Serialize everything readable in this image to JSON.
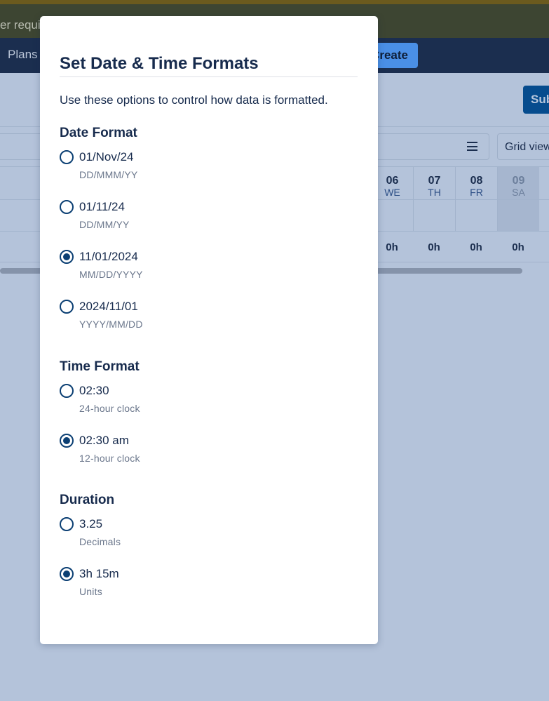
{
  "background": {
    "banner_text": "er requi",
    "nav_plans": "Plans",
    "nav_create": "Create",
    "submit_button": "Sub",
    "grid_view": "Grid view",
    "days": [
      {
        "date": "06",
        "weekday": "WE",
        "hours": "0h",
        "weekend": false
      },
      {
        "date": "07",
        "weekday": "TH",
        "hours": "0h",
        "weekend": false
      },
      {
        "date": "08",
        "weekday": "FR",
        "hours": "0h",
        "weekend": false
      },
      {
        "date": "09",
        "weekday": "SA",
        "hours": "0h",
        "weekend": true
      }
    ]
  },
  "modal": {
    "title": "Set Date & Time Formats",
    "description": "Use these options to control how data is formatted.",
    "sections": [
      {
        "heading": "Date Format",
        "options": [
          {
            "label": "01/Nov/24",
            "sub": "DD/MMM/YY",
            "checked": false
          },
          {
            "label": "01/11/24",
            "sub": "DD/MM/YY",
            "checked": false
          },
          {
            "label": "11/01/2024",
            "sub": "MM/DD/YYYY",
            "checked": true
          },
          {
            "label": "2024/11/01",
            "sub": "YYYY/MM/DD",
            "checked": false
          }
        ]
      },
      {
        "heading": "Time Format",
        "options": [
          {
            "label": "02:30",
            "sub": "24-hour clock",
            "checked": false
          },
          {
            "label": "02:30 am",
            "sub": "12-hour clock",
            "checked": true
          }
        ]
      },
      {
        "heading": "Duration",
        "options": [
          {
            "label": "3.25",
            "sub": "Decimals",
            "checked": false
          },
          {
            "label": "3h 15m",
            "sub": "Units",
            "checked": true
          }
        ]
      }
    ]
  },
  "colors": {
    "overlay_background": "#b4c3da",
    "radio_accent": "#0b3f73",
    "text_primary": "#172b4d",
    "text_secondary": "#6b778c"
  }
}
